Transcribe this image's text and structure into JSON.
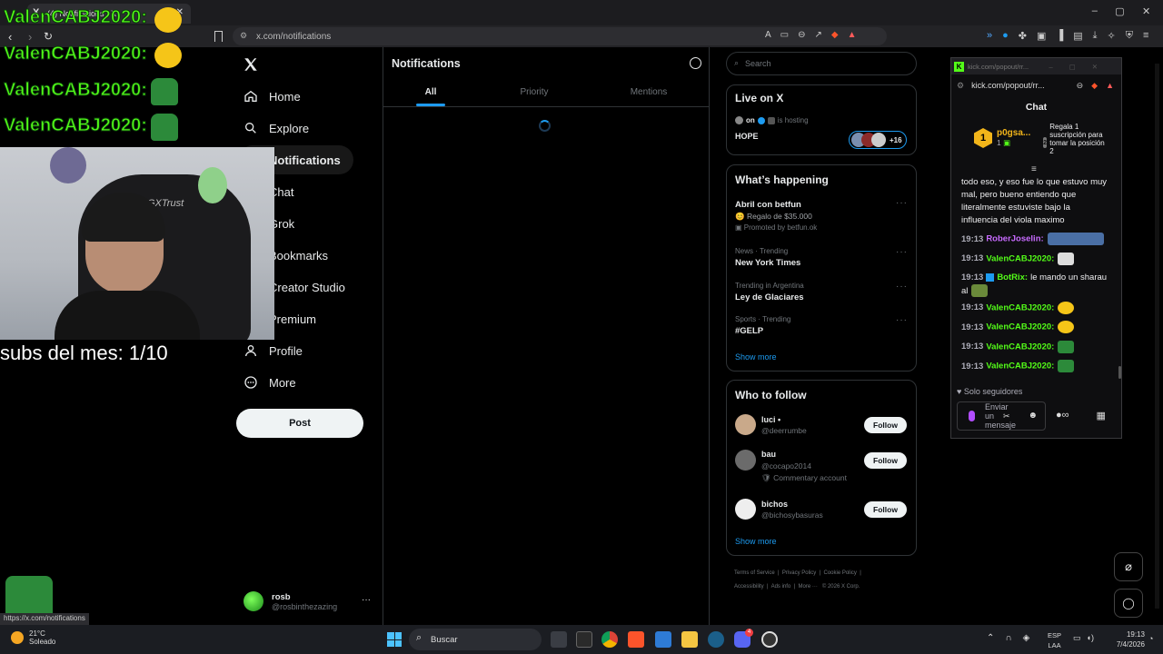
{
  "browser": {
    "tab_title": "(4) Notifications / X",
    "url": "x.com/notifications",
    "status_url": "https://x.com/notifications"
  },
  "overlay": {
    "chat_lines": [
      "ValenCABJ2020:",
      "ValenCABJ2020:",
      "ValenCABJ2020:",
      "ValenCABJ2020:"
    ],
    "subs_text": "subs del mes: 1/10",
    "chair_brand": "GXTrust"
  },
  "x_nav": {
    "items": [
      {
        "label": "Home",
        "icon": "home-icon"
      },
      {
        "label": "Explore",
        "icon": "search-icon"
      },
      {
        "label": "Notifications",
        "icon": "bell-icon"
      },
      {
        "label": "Chat",
        "icon": "chat-icon"
      },
      {
        "label": "Grok",
        "icon": "grok-icon"
      },
      {
        "label": "Bookmarks",
        "icon": "bookmark-icon"
      },
      {
        "label": "Creator Studio",
        "icon": "creator-icon"
      },
      {
        "label": "Premium",
        "icon": "premium-icon"
      },
      {
        "label": "Profile",
        "icon": "person-icon"
      },
      {
        "label": "More",
        "icon": "more-icon"
      }
    ],
    "post_label": "Post",
    "account_name": "rosb",
    "account_handle": "@rosbinthezazing"
  },
  "center": {
    "title": "Notifications",
    "tabs": [
      "All",
      "Priority",
      "Mentions"
    ],
    "active_tab": "All"
  },
  "right": {
    "search_placeholder": "Search",
    "live": {
      "title": "Live on X",
      "host_name": "on",
      "host_suffix": "is hosting",
      "stream_title": "HOPE",
      "extra_count": "+16"
    },
    "happening": {
      "title": "What’s happening",
      "items": [
        {
          "name": "Abril con betfun",
          "sub": "Regalo de $35.000",
          "meta": "Promoted by betfun.ok"
        },
        {
          "context": "News · Trending",
          "name": "New York Times"
        },
        {
          "context": "Trending in Argentina",
          "name": "Ley de Glaciares"
        },
        {
          "context": "Sports · Trending",
          "name": "#GELP"
        }
      ],
      "show_more": "Show more"
    },
    "who_to_follow": {
      "title": "Who to follow",
      "users": [
        {
          "name": "luci •",
          "handle": "@deerrumbe",
          "note": ""
        },
        {
          "name": "bau",
          "handle": "@cocapo2014",
          "note": "Commentary account"
        },
        {
          "name": "bichos",
          "handle": "@bichosybasuras",
          "note": ""
        }
      ],
      "follow_label": "Follow",
      "show_more": "Show more"
    },
    "footer": [
      "Terms of Service",
      "Privacy Policy",
      "Cookie Policy",
      "Accessibility",
      "Ads info",
      "More ···",
      "© 2026 X Corp."
    ]
  },
  "kick": {
    "window_url": "kick.com/popout/rr...",
    "inner_url": "kick.com/popout/rr...",
    "header": "Chat",
    "top_gifter": {
      "rank": "1",
      "name": "p0gsa...",
      "count": "1"
    },
    "gift_promo": "Regala 1 suscripción para tomar la posición 2",
    "gift_rank": "2",
    "message_intro": "todo eso, y eso fue lo que estuvo muy mal, pero bueno entiendo que literalmente estuviste bajo la influencia del viola maximo",
    "messages": [
      {
        "time": "19:13",
        "user": "RoberJoselin:",
        "user_color": "#c86bff",
        "text": ""
      },
      {
        "time": "19:13",
        "user": "ValenCABJ2020:",
        "user_color": "#53fc18",
        "text": ""
      },
      {
        "time": "19:13",
        "user": "BotRix:",
        "user_color": "#53fc18",
        "text": "le mando un sharau al"
      },
      {
        "time": "19:13",
        "user": "ValenCABJ2020:",
        "user_color": "#53fc18",
        "text": ""
      },
      {
        "time": "19:13",
        "user": "ValenCABJ2020:",
        "user_color": "#53fc18",
        "text": ""
      },
      {
        "time": "19:13",
        "user": "ValenCABJ2020:",
        "user_color": "#53fc18",
        "text": ""
      },
      {
        "time": "19:13",
        "user": "ValenCABJ2020:",
        "user_color": "#53fc18",
        "text": ""
      }
    ],
    "followers_only": "Solo seguidores",
    "input_placeholder": "Enviar un mensaje"
  },
  "taskbar": {
    "weather_temp": "21°C",
    "weather_text": "Soleado",
    "search_label": "Buscar",
    "lang": "ESP",
    "lang_sub": "LAA",
    "time": "19:13",
    "date": "7/4/2026",
    "discord_badge": "4"
  },
  "colors": {
    "x_accent": "#1d9bf0",
    "kick_green": "#53fc18",
    "background": "#000000"
  }
}
